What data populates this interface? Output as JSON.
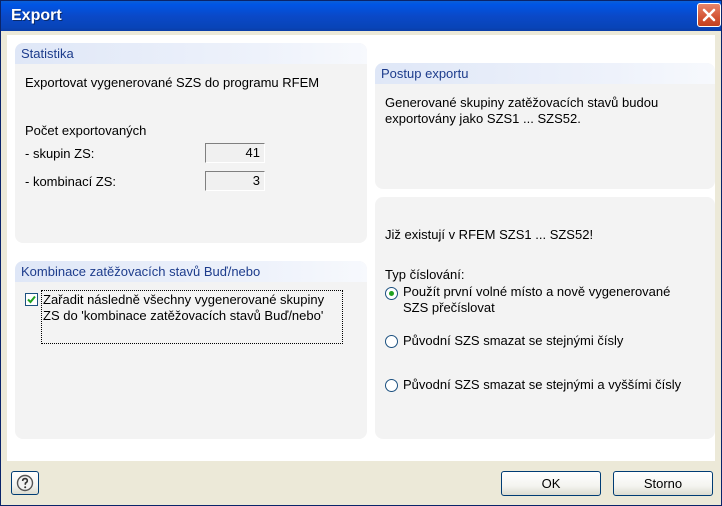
{
  "window": {
    "title": "Export"
  },
  "statistics": {
    "header": "Statistika",
    "description": "Exportovat vygenerované SZS do programu RFEM",
    "count_label": "Počet exportovaných",
    "groups_label": "- skupin ZS:",
    "groups_value": "41",
    "combinations_label": "- kombinací ZS:",
    "combinations_value": "3"
  },
  "export_procedure": {
    "header": "Postup exportu",
    "text": "Generované skupiny zatěžovacích stavů budou exportovány jako SZS1 ... SZS52."
  },
  "combinations_panel": {
    "header": "Kombinace zatěžovacích stavů Buď/nebo",
    "checkbox_label": "Zařadit následně všechny vygenerované skupiny ZS do 'kombinace zatěžovacích stavů Buď/nebo'",
    "checkbox_checked": true
  },
  "numbering": {
    "exists_message": "Již existují v RFEM SZS1 ... SZS52!",
    "type_label": "Typ číslování:",
    "options": [
      {
        "label": "Použít první volné místo a nově vygenerované SZS přečíslovat",
        "selected": true
      },
      {
        "label": "Původní SZS smazat se stejnými čísly",
        "selected": false
      },
      {
        "label": "Původní SZS smazat se stejnými a vyššími čísly",
        "selected": false
      }
    ]
  },
  "buttons": {
    "ok": "OK",
    "cancel": "Storno"
  },
  "icons": {
    "close": "close-icon",
    "help": "help-icon",
    "check": "checkmark-icon"
  },
  "colors": {
    "title_bar": "#0a49c8",
    "panel_header_text": "#1d3c8c",
    "radio_selected": "#21a121",
    "close_button": "#d45535"
  }
}
